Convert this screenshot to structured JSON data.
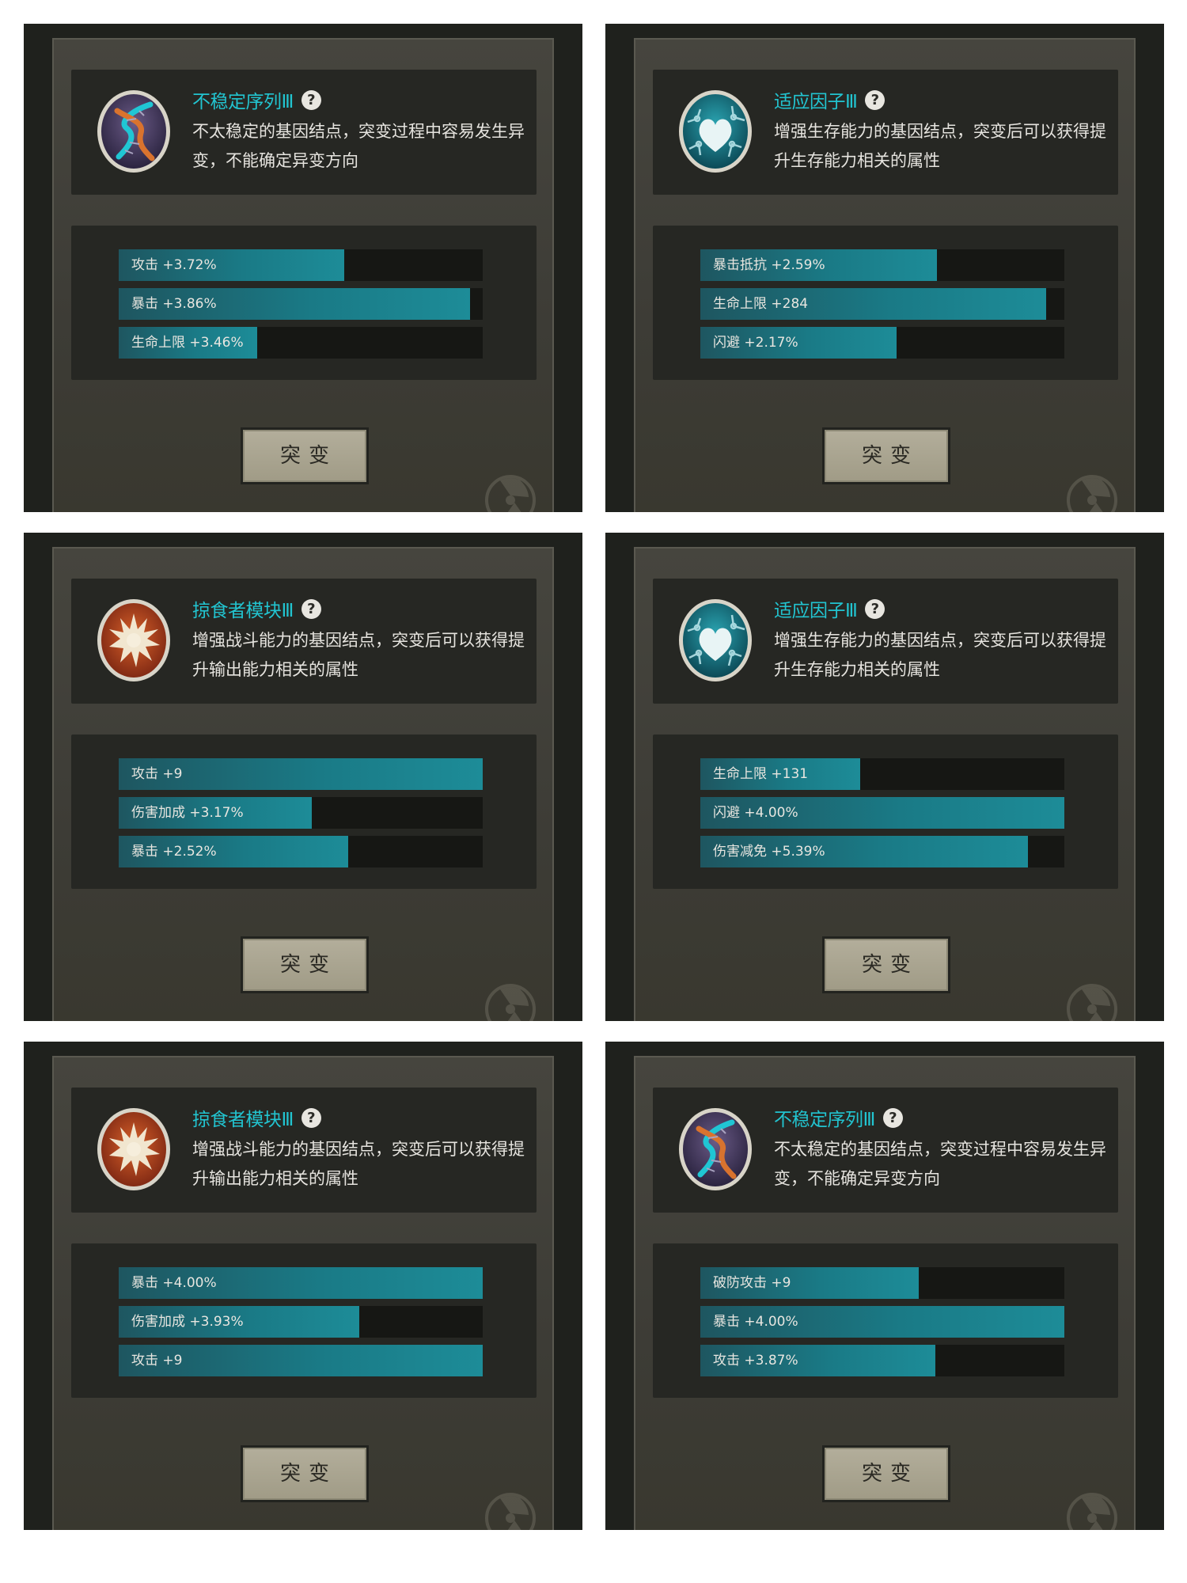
{
  "colors": {
    "title_accent": "#22c4d0",
    "bar_fill": "#1a7a86",
    "panel_bg": "#3d3c36",
    "button_bg": "#a09b86"
  },
  "panels": [
    {
      "icon": "dna-icon",
      "title": "不稳定序列Ⅲ",
      "description": "不太稳定的基因结点，突变过程中容易发生异变，不能确定异变方向",
      "stats": [
        {
          "label": "攻击 +3.72%",
          "fill": 0.62
        },
        {
          "label": "暴击 +3.86%",
          "fill": 0.965
        },
        {
          "label": "生命上限 +3.46%",
          "fill": 0.38
        }
      ],
      "button": "突变"
    },
    {
      "icon": "heart-cell-icon",
      "title": "适应因子Ⅲ",
      "description": "增强生存能力的基因结点，突变后可以获得提升生存能力相关的属性",
      "stats": [
        {
          "label": "暴击抵抗 +2.59%",
          "fill": 0.65
        },
        {
          "label": "生命上限 +284",
          "fill": 0.95
        },
        {
          "label": "闪避 +2.17%",
          "fill": 0.54
        }
      ],
      "button": "突变"
    },
    {
      "icon": "predator-burst-icon",
      "title": "掠食者模块Ⅲ",
      "description": "增强战斗能力的基因结点，突变后可以获得提升输出能力相关的属性",
      "stats": [
        {
          "label": "攻击 +9",
          "fill": 1.0
        },
        {
          "label": "伤害加成 +3.17%",
          "fill": 0.53
        },
        {
          "label": "暴击 +2.52%",
          "fill": 0.63
        }
      ],
      "button": "突变"
    },
    {
      "icon": "heart-cell-icon",
      "title": "适应因子Ⅲ",
      "description": "增强生存能力的基因结点，突变后可以获得提升生存能力相关的属性",
      "stats": [
        {
          "label": "生命上限 +131",
          "fill": 0.44
        },
        {
          "label": "闪避 +4.00%",
          "fill": 1.0
        },
        {
          "label": "伤害减免 +5.39%",
          "fill": 0.9
        }
      ],
      "button": "突变"
    },
    {
      "icon": "predator-burst-icon",
      "title": "掠食者模块Ⅲ",
      "description": "增强战斗能力的基因结点，突变后可以获得提升输出能力相关的属性",
      "stats": [
        {
          "label": "暴击 +4.00%",
          "fill": 1.0
        },
        {
          "label": "伤害加成 +3.93%",
          "fill": 0.66
        },
        {
          "label": "攻击 +9",
          "fill": 1.0
        }
      ],
      "button": "突变"
    },
    {
      "icon": "dna-icon",
      "title": "不稳定序列Ⅲ",
      "description": "不太稳定的基因结点，突变过程中容易发生异变，不能确定异变方向",
      "stats": [
        {
          "label": "破防攻击 +9",
          "fill": 0.6
        },
        {
          "label": "暴击 +4.00%",
          "fill": 1.0
        },
        {
          "label": "攻击 +3.87%",
          "fill": 0.645
        }
      ],
      "button": "突变"
    }
  ]
}
